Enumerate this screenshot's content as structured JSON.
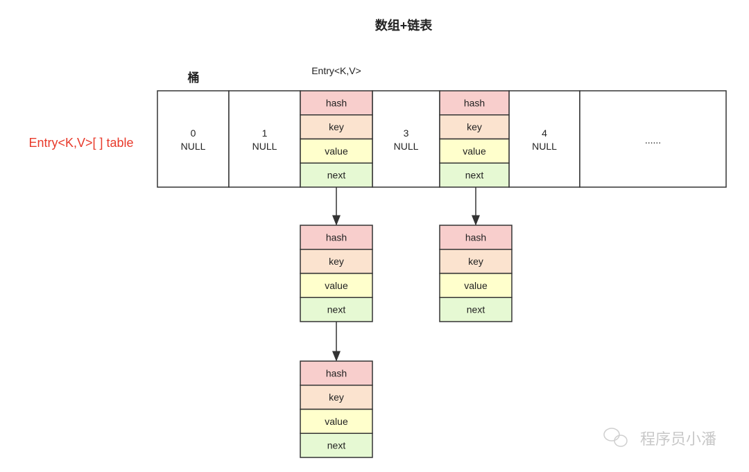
{
  "title": "数组+链表",
  "bucket_label": "桶",
  "entry_label": "Entry<K,V>",
  "table_label": "Entry<K,V>[ ] table",
  "fields": [
    "hash",
    "key",
    "value",
    "next"
  ],
  "field_colors": [
    "#f8cecc",
    "#fbe3cf",
    "#ffffcc",
    "#e6f9d3"
  ],
  "accent_color": "#e8392a",
  "buckets": [
    {
      "index": "0",
      "value": "NULL"
    },
    {
      "index": "1",
      "value": "NULL"
    },
    {
      "entry": true
    },
    {
      "index": "3",
      "value": "NULL"
    },
    {
      "entry": true
    },
    {
      "index": "4",
      "value": "NULL"
    },
    {
      "index": "",
      "value": "......"
    }
  ],
  "watermark": "程序员小潘"
}
